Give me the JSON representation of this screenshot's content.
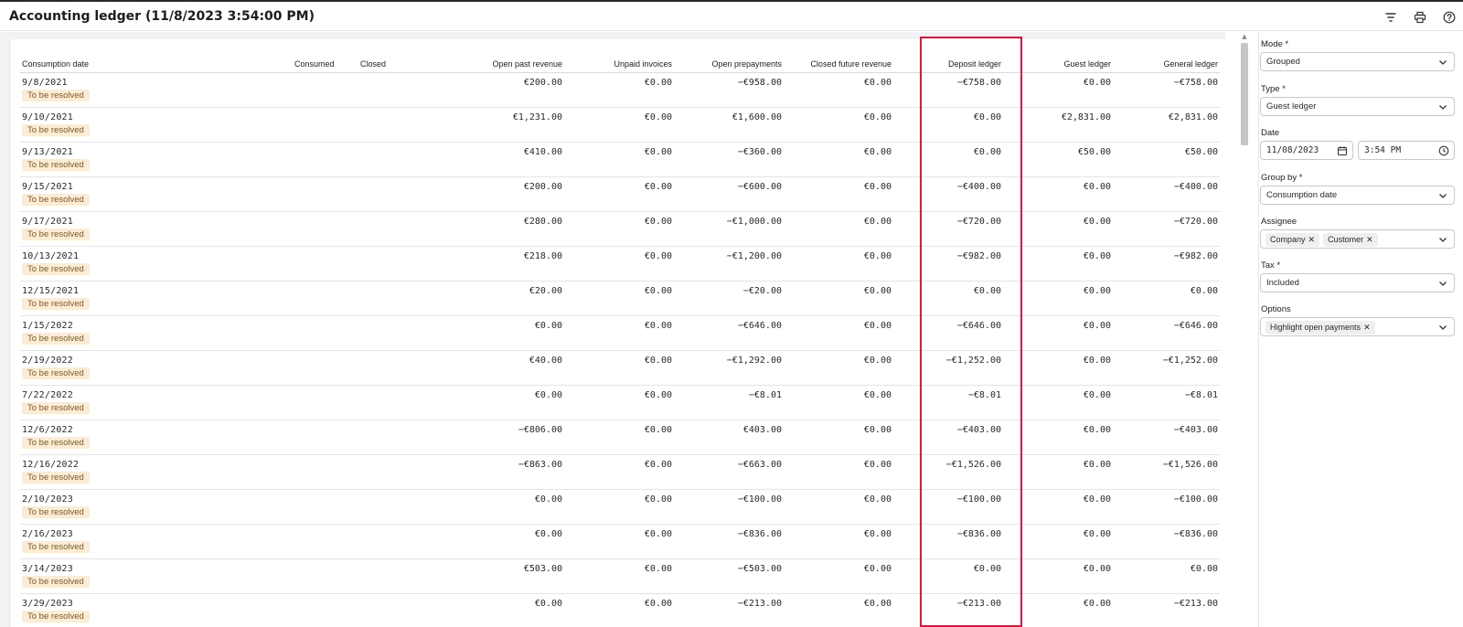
{
  "header": {
    "title": "Accounting ledger (11/8/2023 3:54:00 PM)",
    "icons": [
      "filter-icon",
      "print-icon",
      "help-icon"
    ]
  },
  "table": {
    "columns": [
      "Consumption date",
      "Consumed",
      "Closed",
      "Open past revenue",
      "Unpaid invoices",
      "Open prepayments",
      "Closed future revenue",
      "Deposit ledger",
      "Guest ledger",
      "General ledger"
    ],
    "rows": [
      {
        "date": "9/8/2021",
        "status": "To be resolved",
        "consumed": "",
        "closed": "",
        "open_past_revenue": "€200.00",
        "unpaid_invoices": "€0.00",
        "open_prepayments": "−€958.00",
        "closed_future_revenue": "€0.00",
        "deposit_ledger": "−€758.00",
        "guest_ledger": "€0.00",
        "general_ledger": "−€758.00"
      },
      {
        "date": "9/10/2021",
        "status": "To be resolved",
        "consumed": "",
        "closed": "",
        "open_past_revenue": "€1,231.00",
        "unpaid_invoices": "€0.00",
        "open_prepayments": "€1,600.00",
        "closed_future_revenue": "€0.00",
        "deposit_ledger": "€0.00",
        "guest_ledger": "€2,831.00",
        "general_ledger": "€2,831.00"
      },
      {
        "date": "9/13/2021",
        "status": "To be resolved",
        "consumed": "",
        "closed": "",
        "open_past_revenue": "€410.00",
        "unpaid_invoices": "€0.00",
        "open_prepayments": "−€360.00",
        "closed_future_revenue": "€0.00",
        "deposit_ledger": "€0.00",
        "guest_ledger": "€50.00",
        "general_ledger": "€50.00"
      },
      {
        "date": "9/15/2021",
        "status": "To be resolved",
        "consumed": "",
        "closed": "",
        "open_past_revenue": "€200.00",
        "unpaid_invoices": "€0.00",
        "open_prepayments": "−€600.00",
        "closed_future_revenue": "€0.00",
        "deposit_ledger": "−€400.00",
        "guest_ledger": "€0.00",
        "general_ledger": "−€400.00"
      },
      {
        "date": "9/17/2021",
        "status": "To be resolved",
        "consumed": "",
        "closed": "",
        "open_past_revenue": "€280.00",
        "unpaid_invoices": "€0.00",
        "open_prepayments": "−€1,000.00",
        "closed_future_revenue": "€0.00",
        "deposit_ledger": "−€720.00",
        "guest_ledger": "€0.00",
        "general_ledger": "−€720.00"
      },
      {
        "date": "10/13/2021",
        "status": "To be resolved",
        "consumed": "",
        "closed": "",
        "open_past_revenue": "€218.00",
        "unpaid_invoices": "€0.00",
        "open_prepayments": "−€1,200.00",
        "closed_future_revenue": "€0.00",
        "deposit_ledger": "−€982.00",
        "guest_ledger": "€0.00",
        "general_ledger": "−€982.00"
      },
      {
        "date": "12/15/2021",
        "status": "To be resolved",
        "consumed": "",
        "closed": "",
        "open_past_revenue": "€20.00",
        "unpaid_invoices": "€0.00",
        "open_prepayments": "−€20.00",
        "closed_future_revenue": "€0.00",
        "deposit_ledger": "€0.00",
        "guest_ledger": "€0.00",
        "general_ledger": "€0.00"
      },
      {
        "date": "1/15/2022",
        "status": "To be resolved",
        "consumed": "",
        "closed": "",
        "open_past_revenue": "€0.00",
        "unpaid_invoices": "€0.00",
        "open_prepayments": "−€646.00",
        "closed_future_revenue": "€0.00",
        "deposit_ledger": "−€646.00",
        "guest_ledger": "€0.00",
        "general_ledger": "−€646.00"
      },
      {
        "date": "2/19/2022",
        "status": "To be resolved",
        "consumed": "",
        "closed": "",
        "open_past_revenue": "€40.00",
        "unpaid_invoices": "€0.00",
        "open_prepayments": "−€1,292.00",
        "closed_future_revenue": "€0.00",
        "deposit_ledger": "−€1,252.00",
        "guest_ledger": "€0.00",
        "general_ledger": "−€1,252.00"
      },
      {
        "date": "7/22/2022",
        "status": "To be resolved",
        "consumed": "",
        "closed": "",
        "open_past_revenue": "€0.00",
        "unpaid_invoices": "€0.00",
        "open_prepayments": "−€8.01",
        "closed_future_revenue": "€0.00",
        "deposit_ledger": "−€8.01",
        "guest_ledger": "€0.00",
        "general_ledger": "−€8.01"
      },
      {
        "date": "12/6/2022",
        "status": "To be resolved",
        "consumed": "",
        "closed": "",
        "open_past_revenue": "−€806.00",
        "unpaid_invoices": "€0.00",
        "open_prepayments": "€403.00",
        "closed_future_revenue": "€0.00",
        "deposit_ledger": "−€403.00",
        "guest_ledger": "€0.00",
        "general_ledger": "−€403.00"
      },
      {
        "date": "12/16/2022",
        "status": "To be resolved",
        "consumed": "",
        "closed": "",
        "open_past_revenue": "−€863.00",
        "unpaid_invoices": "€0.00",
        "open_prepayments": "−€663.00",
        "closed_future_revenue": "€0.00",
        "deposit_ledger": "−€1,526.00",
        "guest_ledger": "€0.00",
        "general_ledger": "−€1,526.00"
      },
      {
        "date": "2/10/2023",
        "status": "To be resolved",
        "consumed": "",
        "closed": "",
        "open_past_revenue": "€0.00",
        "unpaid_invoices": "€0.00",
        "open_prepayments": "−€100.00",
        "closed_future_revenue": "€0.00",
        "deposit_ledger": "−€100.00",
        "guest_ledger": "€0.00",
        "general_ledger": "−€100.00"
      },
      {
        "date": "2/16/2023",
        "status": "To be resolved",
        "consumed": "",
        "closed": "",
        "open_past_revenue": "€0.00",
        "unpaid_invoices": "€0.00",
        "open_prepayments": "−€836.00",
        "closed_future_revenue": "€0.00",
        "deposit_ledger": "−€836.00",
        "guest_ledger": "€0.00",
        "general_ledger": "−€836.00"
      },
      {
        "date": "3/14/2023",
        "status": "To be resolved",
        "consumed": "",
        "closed": "",
        "open_past_revenue": "€503.00",
        "unpaid_invoices": "€0.00",
        "open_prepayments": "−€503.00",
        "closed_future_revenue": "€0.00",
        "deposit_ledger": "€0.00",
        "guest_ledger": "€0.00",
        "general_ledger": "€0.00"
      },
      {
        "date": "3/29/2023",
        "status": "To be resolved",
        "consumed": "",
        "closed": "",
        "open_past_revenue": "€0.00",
        "unpaid_invoices": "€0.00",
        "open_prepayments": "−€213.00",
        "closed_future_revenue": "€0.00",
        "deposit_ledger": "−€213.00",
        "guest_ledger": "€0.00",
        "general_ledger": "−€213.00"
      }
    ]
  },
  "sidebar": {
    "mode": {
      "label": "Mode *",
      "value": "Grouped"
    },
    "type": {
      "label": "Type *",
      "value": "Guest ledger"
    },
    "date": {
      "label": "Date",
      "date_value": "11/08/2023",
      "time_value": "3:54 PM"
    },
    "group_by": {
      "label": "Group by *",
      "value": "Consumption date"
    },
    "assignee": {
      "label": "Assignee",
      "chips": [
        "Company",
        "Customer"
      ],
      "remove_glyph": "✕"
    },
    "tax": {
      "label": "Tax *",
      "value": "Included"
    },
    "options": {
      "label": "Options",
      "chips": [
        "Highlight open payments"
      ],
      "remove_glyph": "✕"
    }
  },
  "colors": {
    "highlight_border": "#e0163c",
    "badge_bg": "#fbecd7",
    "badge_text": "#7d5a26"
  }
}
